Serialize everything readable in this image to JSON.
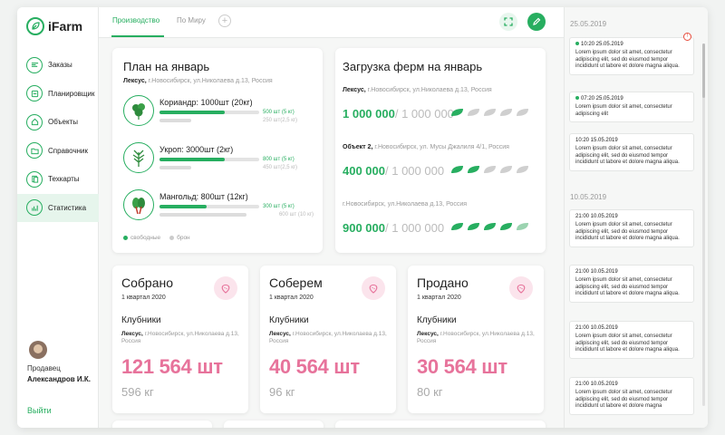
{
  "brand": {
    "name": "iFarm",
    "color": "#27ae60"
  },
  "sidebar": {
    "items": [
      {
        "label": "Заказы",
        "icon": "orders-icon"
      },
      {
        "label": "Планировщик",
        "icon": "planner-icon"
      },
      {
        "label": "Объекты",
        "icon": "home-icon"
      },
      {
        "label": "Справочник",
        "icon": "folder-icon"
      },
      {
        "label": "Техкарты",
        "icon": "documents-icon"
      },
      {
        "label": "Статистика",
        "icon": "chart-icon",
        "active": true
      }
    ],
    "user": {
      "role": "Продавец",
      "name": "Александров И.К."
    },
    "logout": "Выйти"
  },
  "tabs": [
    {
      "label": "Производство",
      "active": true
    },
    {
      "label": "По Миру",
      "active": false
    }
  ],
  "plan": {
    "title": "План на январь",
    "address_bold": "Лексус,",
    "address": "г.Новосибирск, ул.Николаева д.13, Россия",
    "items": [
      {
        "name": "Кориандр: 1000шт (20кг)",
        "free_label": "500 шт (5 кг)",
        "busy_label": "250 шт(2,5 кг)",
        "free_fraction": 0.65,
        "busy_fraction": 0.32
      },
      {
        "name": "Укроп: 3000шт (2кг)",
        "free_label": "800 шт (5 кг)",
        "busy_label": "450 шт(2,5 кг)",
        "free_fraction": 0.65,
        "busy_fraction": 0.32
      },
      {
        "name": "Мангольд: 800шт (12кг)",
        "free_label": "300 шт (5 кг)",
        "busy_label": "600 шт (10 кг)",
        "free_fraction": 0.47,
        "busy_fraction": 0.75
      }
    ],
    "legend": {
      "free": "свободные",
      "busy": "брон"
    }
  },
  "load": {
    "title": "Загрузка ферм на январь",
    "rows": [
      {
        "address_bold": "Лексус,",
        "address": "г.Новосибирск, ул.Николаева д.13, Россия",
        "value": "1 000 000",
        "total": "/ 1 000 000",
        "leaves_full": 1,
        "leaves_half": 0
      },
      {
        "address_bold": "Объект 2,",
        "address": "г.Новосибирск, ул. Мусы Джалиля 4/1, Россия",
        "value": "400 000",
        "total": "/ 1 000 000",
        "leaves_full": 2,
        "leaves_half": 0
      },
      {
        "address_bold": "",
        "address": "г.Новосибирск, ул.Николаева д.13, Россия",
        "value": "900 000",
        "total": "/ 1 000 000",
        "leaves_full": 4,
        "leaves_half": 1
      }
    ]
  },
  "stats": [
    {
      "title": "Собрано",
      "period": "1 квартал 2020",
      "product": "Клубники",
      "address_bold": "Лексус,",
      "address": "г.Новосибирск, ул.Николаева д.13, Россия",
      "amount": "121 564 шт",
      "weight": "596 кг"
    },
    {
      "title": "Соберем",
      "period": "1 квартал 2020",
      "product": "Клубники",
      "address_bold": "Лексус,",
      "address": "г.Новосибирск, ул.Николаева д.13, Россия",
      "amount": "40 564 шт",
      "weight": "96 кг"
    },
    {
      "title": "Продано",
      "period": "1 квартал 2020",
      "product": "Клубники",
      "address_bold": "Лексус,",
      "address": "г.Новосибирск, ул.Николаева д.13, Россия",
      "amount": "30 564 шт",
      "weight": "80 кг"
    }
  ],
  "notifications": {
    "groups": [
      {
        "date": "25.05.2019",
        "items": [
          {
            "time": "10:20 25.05.2019",
            "text": "Lorem ipsum dolor sit amet, consectetur adipiscing elit, sed do eiusmod tempor incididunt ut labore et dolore magna aliqua.",
            "alert": "!"
          },
          {
            "time": "07:20 25.05.2019",
            "text": "Lorem ipsum dolor sit amet, consectetur adipiscing elit"
          },
          {
            "time": "10:20 15.05.2019",
            "text": "Lorem ipsum dolor sit amet, consectetur adipiscing elit, sed do eiusmod tempor incididunt ut labore et dolore magna aliqua."
          }
        ]
      },
      {
        "date": "10.05.2019",
        "items": [
          {
            "time": "21:00 10.05.2019",
            "text": "Lorem ipsum dolor sit amet, consectetur adipiscing elit, sed do eiusmod tempor incididunt ut labore et dolore magna aliqua."
          },
          {
            "time": "21:00 10.05.2019",
            "text": "Lorem ipsum dolor sit amet, consectetur adipiscing elit, sed do eiusmod tempor incididunt ut labore et dolore magna aliqua."
          },
          {
            "time": "21:00 10.05.2019",
            "text": "Lorem ipsum dolor sit amet, consectetur adipiscing elit, sed do eiusmod tempor incididunt ut labore et dolore magna aliqua."
          },
          {
            "time": "21:00 10.05.2019",
            "text": "Lorem ipsum dolor sit amet, consectetur adipiscing elit, sed do eiusmod tempor incididunt ut labore et dolore magna"
          }
        ]
      }
    ]
  },
  "colors": {
    "accent": "#27ae60",
    "pink": "#e7739b",
    "muted": "#bbbbbb"
  }
}
